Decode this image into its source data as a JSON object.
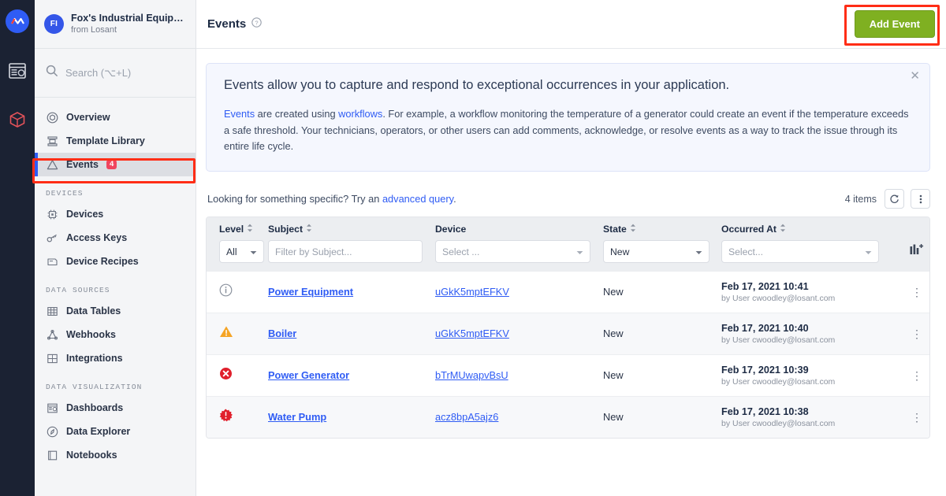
{
  "rail": {
    "logo_icon": "losant-logo-icon",
    "items": [
      {
        "icon": "dashboard-icon",
        "name": "rail-item-dashboard"
      },
      {
        "icon": "cube-icon",
        "name": "rail-item-applications"
      }
    ]
  },
  "sidebar": {
    "avatar_initials": "FI",
    "app_title": "Fox's Industrial Equipm…",
    "app_subtitle": "from Losant",
    "search": {
      "placeholder": "Search (⌥+L)",
      "icon": "search-icon"
    },
    "items": [
      {
        "label": "Overview",
        "icon": "overview-icon",
        "active": false
      },
      {
        "label": "Template Library",
        "icon": "template-library-icon",
        "active": false
      },
      {
        "label": "Events",
        "icon": "warning-triangle-icon",
        "active": true,
        "badge": "4"
      }
    ],
    "groups": [
      {
        "title": "DEVICES",
        "items": [
          {
            "label": "Devices",
            "icon": "chip-icon"
          },
          {
            "label": "Access Keys",
            "icon": "key-icon"
          },
          {
            "label": "Device Recipes",
            "icon": "recipe-icon"
          }
        ]
      },
      {
        "title": "DATA SOURCES",
        "items": [
          {
            "label": "Data Tables",
            "icon": "grid-icon"
          },
          {
            "label": "Webhooks",
            "icon": "webhook-icon"
          },
          {
            "label": "Integrations",
            "icon": "integrations-icon"
          }
        ]
      },
      {
        "title": "DATA VISUALIZATION",
        "items": [
          {
            "label": "Dashboards",
            "icon": "dashboard-icon"
          },
          {
            "label": "Data Explorer",
            "icon": "compass-icon"
          },
          {
            "label": "Notebooks",
            "icon": "notebook-icon"
          }
        ]
      }
    ]
  },
  "topbar": {
    "page_title": "Events",
    "help_icon": "question-circle-icon",
    "add_button_label": "Add Event",
    "add_button_color": "#7fb021"
  },
  "banner": {
    "headline": "Events allow you to capture and respond to exceptional occurrences in your application.",
    "body_link_1": "Events",
    "body_text_1": " are created using ",
    "body_link_2": "workflows",
    "body_text_2": ". For example, a workflow monitoring the temperature of a generator could create an event if the temperature exceeds a safe threshold. Your technicians, operators, or other users can add comments, acknowledge, or resolve events as a way to track the issue through its entire life cycle.",
    "close_icon": "close-icon",
    "link_color": "#2f5cf4"
  },
  "query_bar": {
    "text_before": "Looking for something specific? Try an ",
    "link": "advanced query",
    "text_after": ".",
    "items_count": "4 items",
    "refresh_icon": "refresh-icon",
    "more_icon": "kebab-menu-icon"
  },
  "table": {
    "columns": [
      {
        "label": "Level",
        "sortable": true
      },
      {
        "label": "Subject",
        "sortable": true
      },
      {
        "label": "Device",
        "sortable": false
      },
      {
        "label": "State",
        "sortable": true
      },
      {
        "label": "Occurred At",
        "sortable": true
      }
    ],
    "filters": {
      "level": "All",
      "subject_placeholder": "Filter by Subject...",
      "device_placeholder": "Select ...",
      "state": "New",
      "occurred_placeholder": "Select...",
      "columns_icon": "add-column-icon"
    },
    "rows": [
      {
        "level_icon": "info-circle-icon",
        "level_color": "#8b929e",
        "subject": "Power Equipment",
        "device": "uGkK5mptEFKV",
        "state": "New",
        "occurred_at": "Feb 17, 2021 10:41",
        "occurred_by": "by User cwoodley@losant.com",
        "menu_icon": "kebab-menu-icon"
      },
      {
        "level_icon": "warning-triangle-icon",
        "level_color": "#f5a425",
        "subject": "Boiler",
        "device": "uGkK5mptEFKV",
        "state": "New",
        "occurred_at": "Feb 17, 2021 10:40",
        "occurred_by": "by User cwoodley@losant.com",
        "menu_icon": "kebab-menu-icon"
      },
      {
        "level_icon": "error-circle-x-icon",
        "level_color": "#e0202c",
        "subject": "Power Generator",
        "device": "bTrMUwapvBsU",
        "state": "New",
        "occurred_at": "Feb 17, 2021 10:39",
        "occurred_by": "by User cwoodley@losant.com",
        "menu_icon": "kebab-menu-icon"
      },
      {
        "level_icon": "critical-burst-icon",
        "level_color": "#e0202c",
        "subject": "Water Pump",
        "device": "acz8bpA5ajz6",
        "state": "New",
        "occurred_at": "Feb 17, 2021 10:38",
        "occurred_by": "by User cwoodley@losant.com",
        "menu_icon": "kebab-menu-icon"
      }
    ]
  },
  "annotations": {
    "color": "#ff2d16",
    "targets": [
      "sidebar-item-events",
      "add-event-button"
    ]
  }
}
